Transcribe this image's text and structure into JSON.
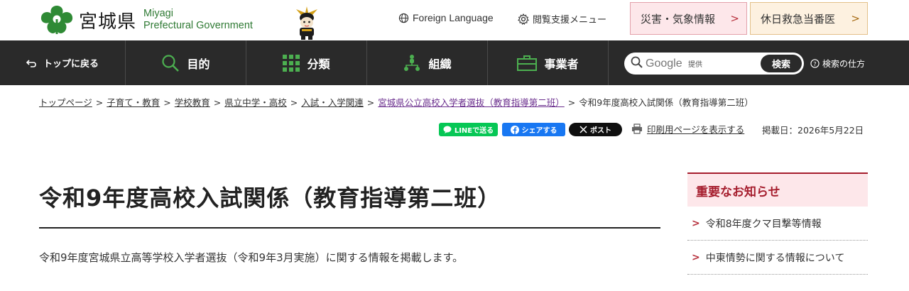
{
  "header": {
    "logo_jp": "宮城県",
    "logo_en_line1": "Miyagi",
    "logo_en_line2": "Prefectural Government",
    "foreign_language": "Foreign Language",
    "accessibility_menu": "閲覧支援メニュー",
    "disaster_info": "災害・気象情報",
    "holiday_clinic": "休日救急当番医"
  },
  "nav": {
    "back_top": "トップに戻る",
    "purpose": "目的",
    "classification": "分類",
    "organization": "組織",
    "business": "事業者",
    "search_placeholder": "Google",
    "search_provided": "提供",
    "search_button": "検索",
    "search_help": "検索の仕方"
  },
  "breadcrumb": {
    "items": [
      "トップページ",
      "子育て・教育",
      "学校教育",
      "県立中学・高校",
      "入試・入学関連",
      "宮城県公立高校入学者選抜（教育指導第二班）"
    ],
    "current": "令和9年度高校入試関係（教育指導第二班）",
    "separator": ">"
  },
  "share": {
    "line": "LINEで送る",
    "facebook": "シェアする",
    "x": "ポスト",
    "print": "印刷用ページを表示する",
    "posted_date": "掲載日：2026年5月22日"
  },
  "main": {
    "title": "令和9年度高校入試関係（教育指導第二班）",
    "intro": "令和9年度宮城県立高等学校入学者選抜（令和9年3月実施）に関する情報を掲載します。"
  },
  "sidebar": {
    "heading": "重要なお知らせ",
    "items": [
      {
        "label": "令和8年度クマ目撃等情報"
      },
      {
        "label": "中東情勢に関する情報について"
      }
    ]
  },
  "colors": {
    "nav_bg": "#2a2a2a",
    "brand_green": "#2f7a34",
    "alert_red": "#a51d2d",
    "line_green": "#06c755",
    "facebook_blue": "#1877f2"
  }
}
